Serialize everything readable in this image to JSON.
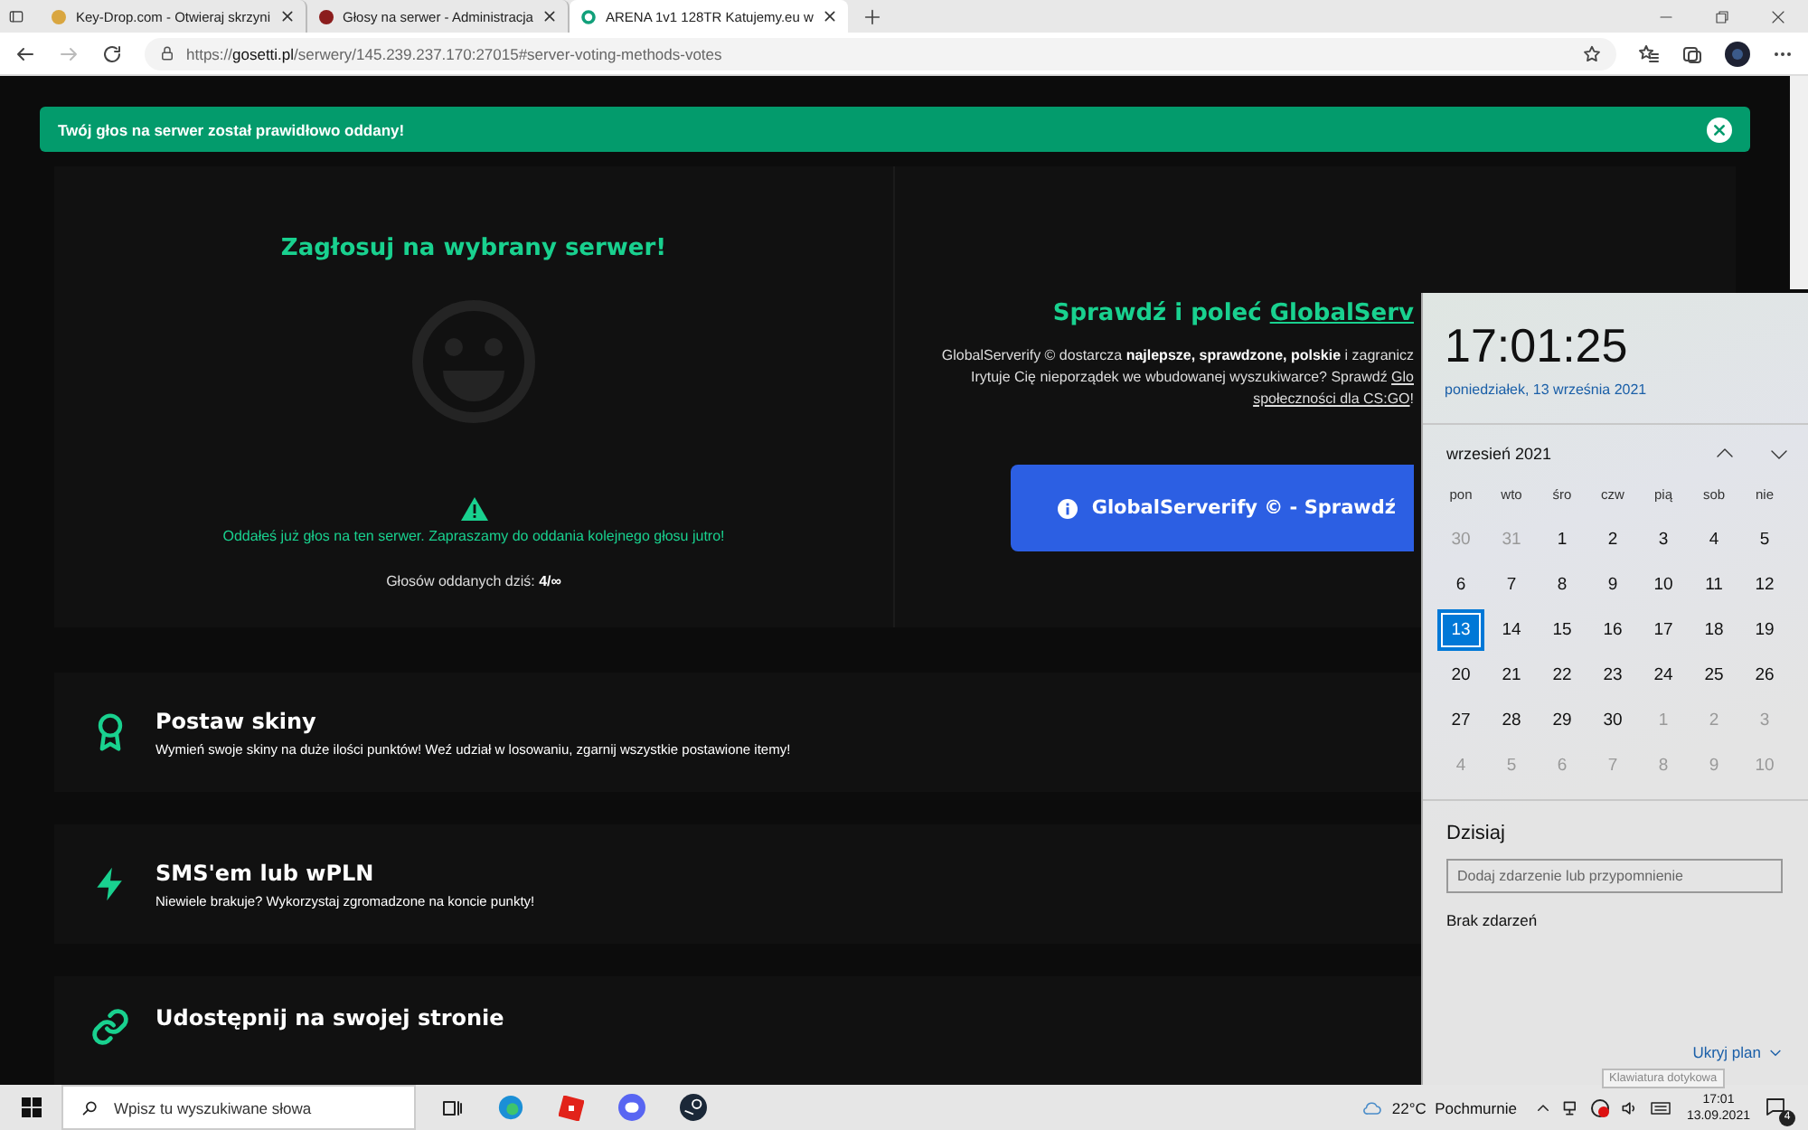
{
  "browser": {
    "tabs": [
      {
        "title": "Key-Drop.com - Otwieraj skrzyni",
        "selected": false
      },
      {
        "title": "Głosy na serwer - Administracja",
        "selected": false
      },
      {
        "title": "ARENA 1v1 128TR Katujemy.eu w",
        "selected": true
      }
    ],
    "address": {
      "scheme": "https://",
      "domain": "gosetti.pl",
      "path": "/serwery/145.239.237.170:27015#server-voting-methods-votes"
    }
  },
  "alert": {
    "message": "Twój głos na serwer został prawidłowo oddany!"
  },
  "vote": {
    "title": "Zagłosuj na wybrany serwer!",
    "warning": "Oddałeś już głos na ten serwer. Zapraszamy do oddania kolejnego głosu jutro!",
    "count": "Głosów oddanych dziś: **4/∞**"
  },
  "recommend": {
    "title": "Sprawdź i poleć ",
    "title_link": "GlobalServ",
    "lines": [
      [
        {
          "text": "GlobalServerify © dostarcza **najlepsze, sprawdzone, polskie** i zagranicz",
          "link": false
        }
      ],
      [
        {
          "text": "Irytuje Cię nieporządek we wbudowanej wyszukiwarce? Sprawdź ",
          "link": false
        },
        {
          "text": "Glo",
          "link": true
        }
      ],
      [
        {
          "text": "społeczności dla CS:GO",
          "link": true
        },
        {
          "text": "!",
          "link": false
        }
      ]
    ],
    "button": "GlobalServerify © - Sprawdź"
  },
  "features": [
    {
      "kind": "award",
      "title": "Postaw skiny",
      "text": "Wymień swoje skiny na duże ilości punktów! Weź udział w losowaniu, zgarnij wszystkie postawione itemy!"
    },
    {
      "kind": "bolt",
      "title": "SMS'em lub wPLN",
      "text": "Niewiele brakuje? Wykorzystaj zgromadzone na koncie punkty!"
    },
    {
      "kind": "link",
      "title": "Udostępnij na swojej stronie"
    }
  ],
  "calendar": {
    "time": "17:01:25",
    "date": "poniedziałek, 13 września 2021",
    "month": "wrzesień 2021",
    "weekdays": [
      "pon",
      "wto",
      "śro",
      "czw",
      "pią",
      "sob",
      "nie"
    ],
    "days": [
      {
        "d": "30",
        "muted": true,
        "selected": false
      },
      {
        "d": "31",
        "muted": true,
        "selected": false
      },
      {
        "d": "1",
        "muted": false,
        "selected": false
      },
      {
        "d": "2",
        "muted": false,
        "selected": false
      },
      {
        "d": "3",
        "muted": false,
        "selected": false
      },
      {
        "d": "4",
        "muted": false,
        "selected": false
      },
      {
        "d": "5",
        "muted": false,
        "selected": false
      },
      {
        "d": "6",
        "muted": false,
        "selected": false
      },
      {
        "d": "7",
        "muted": false,
        "selected": false
      },
      {
        "d": "8",
        "muted": false,
        "selected": false
      },
      {
        "d": "9",
        "muted": false,
        "selected": false
      },
      {
        "d": "10",
        "muted": false,
        "selected": false
      },
      {
        "d": "11",
        "muted": false,
        "selected": false
      },
      {
        "d": "12",
        "muted": false,
        "selected": false
      },
      {
        "d": "13",
        "muted": false,
        "selected": true
      },
      {
        "d": "14",
        "muted": false,
        "selected": false
      },
      {
        "d": "15",
        "muted": false,
        "selected": false
      },
      {
        "d": "16",
        "muted": false,
        "selected": false
      },
      {
        "d": "17",
        "muted": false,
        "selected": false
      },
      {
        "d": "18",
        "muted": false,
        "selected": false
      },
      {
        "d": "19",
        "muted": false,
        "selected": false
      },
      {
        "d": "20",
        "muted": false,
        "selected": false
      },
      {
        "d": "21",
        "muted": false,
        "selected": false
      },
      {
        "d": "22",
        "muted": false,
        "selected": false
      },
      {
        "d": "23",
        "muted": false,
        "selected": false
      },
      {
        "d": "24",
        "muted": false,
        "selected": false
      },
      {
        "d": "25",
        "muted": false,
        "selected": false
      },
      {
        "d": "26",
        "muted": false,
        "selected": false
      },
      {
        "d": "27",
        "muted": false,
        "selected": false
      },
      {
        "d": "28",
        "muted": false,
        "selected": false
      },
      {
        "d": "29",
        "muted": false,
        "selected": false
      },
      {
        "d": "30",
        "muted": false,
        "selected": false
      },
      {
        "d": "1",
        "muted": true,
        "selected": false
      },
      {
        "d": "2",
        "muted": true,
        "selected": false
      },
      {
        "d": "3",
        "muted": true,
        "selected": false
      },
      {
        "d": "4",
        "muted": true,
        "selected": false
      },
      {
        "d": "5",
        "muted": true,
        "selected": false
      },
      {
        "d": "6",
        "muted": true,
        "selected": false
      },
      {
        "d": "7",
        "muted": true,
        "selected": false
      },
      {
        "d": "8",
        "muted": true,
        "selected": false
      },
      {
        "d": "9",
        "muted": true,
        "selected": false
      },
      {
        "d": "10",
        "muted": true,
        "selected": false
      }
    ],
    "today": "Dzisiaj",
    "event_placeholder": "Dodaj zdarzenie lub przypomnienie",
    "no_events": "Brak zdarzeń",
    "hide": "Ukryj plan",
    "tooltip": "Klawiatura dotykowa"
  },
  "taskbar": {
    "search_placeholder": "Wpisz tu wyszukiwane słowa",
    "weather": "22°C  Pochmurnie",
    "time": "17:01",
    "date": "13.09.2021",
    "notifications": "4"
  }
}
